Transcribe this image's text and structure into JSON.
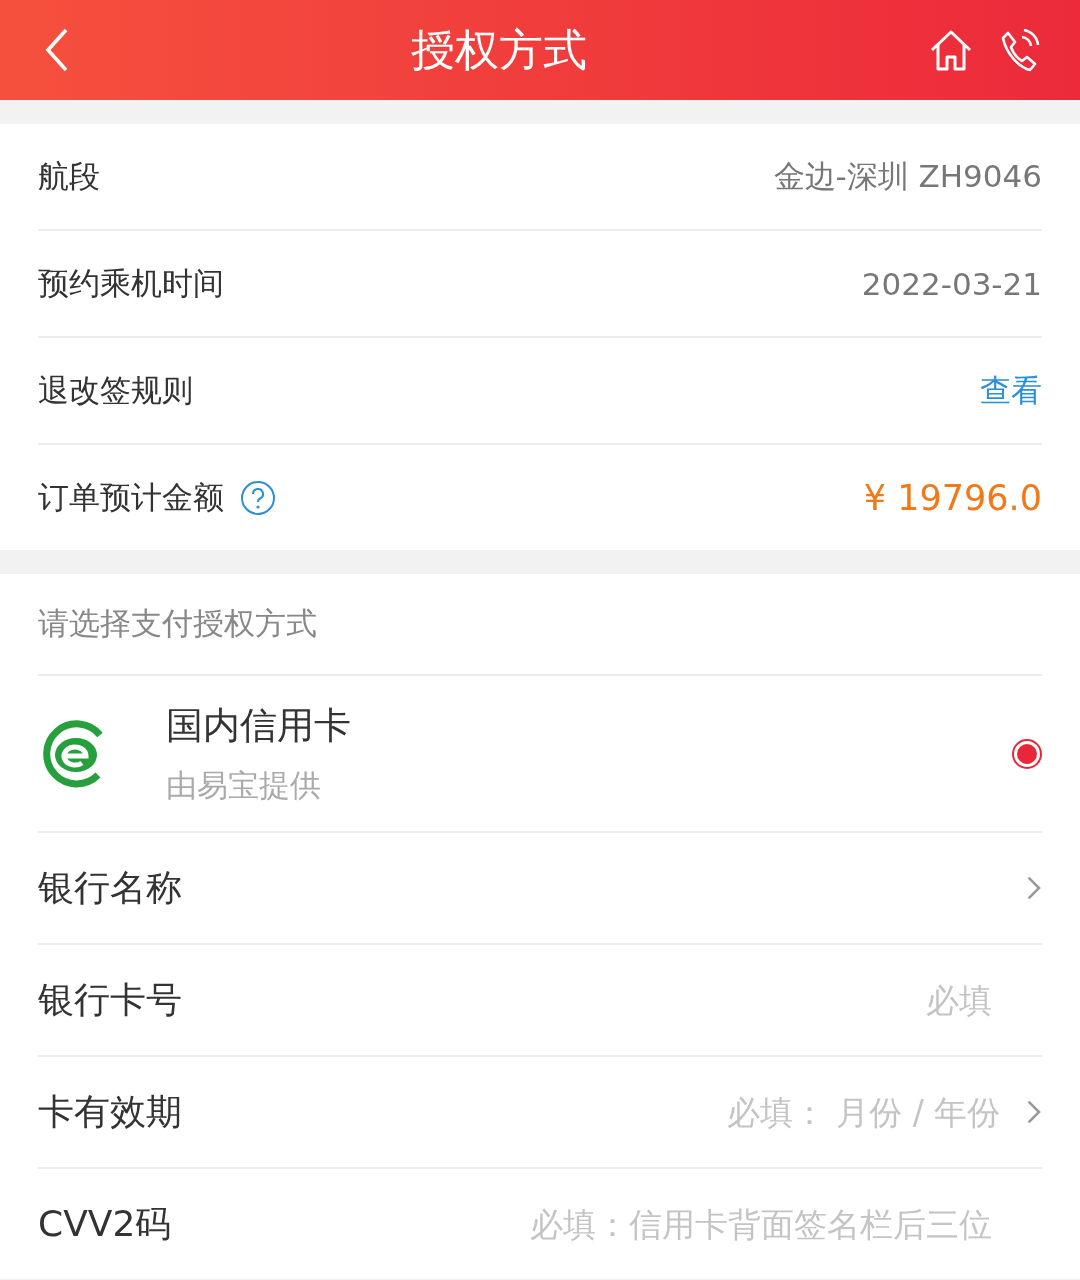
{
  "header": {
    "title": "授权方式"
  },
  "info_rows": [
    {
      "label": "航段",
      "value": "金边-深圳 ZH9046",
      "kind": "text"
    },
    {
      "label": "预约乘机时间",
      "value": "2022-03-21",
      "kind": "text"
    },
    {
      "label": "退改签规则",
      "value": "查看",
      "kind": "link"
    },
    {
      "label": "订单预计金额",
      "value": "¥ 19796.0",
      "kind": "amount",
      "help": true
    }
  ],
  "payment": {
    "prompt": "请选择支付授权方式",
    "methods": [
      {
        "name": "国内信用卡",
        "provider": "由易宝提供",
        "selected": true
      }
    ]
  },
  "form_rows": [
    {
      "label": "银行名称",
      "kind": "select"
    },
    {
      "label": "银行卡号",
      "placeholder": "必填",
      "kind": "input"
    },
    {
      "label": "卡有效期",
      "placeholder": "必填： 月份 / 年份",
      "kind": "select"
    },
    {
      "label": "CVV2码",
      "placeholder": "必填：信用卡背面签名栏后三位",
      "kind": "input"
    }
  ]
}
